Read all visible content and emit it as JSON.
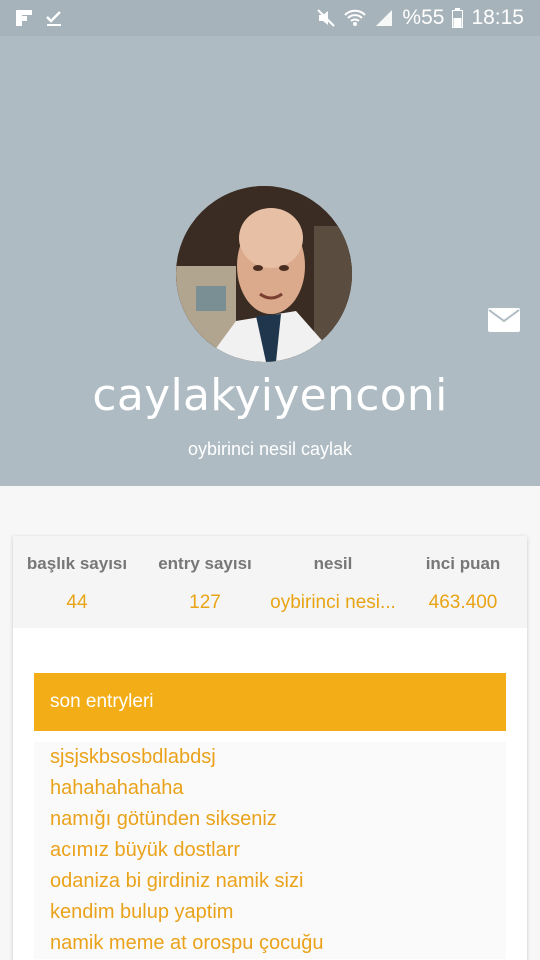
{
  "status_bar": {
    "battery": "%55",
    "time": "18:15",
    "icons": [
      "flipboard-icon",
      "checkmark-icon",
      "mute-icon",
      "wifi-icon",
      "signal-icon",
      "battery-icon"
    ]
  },
  "profile": {
    "username": "caylakyiyenconi",
    "generation": "oybirinci nesil caylak"
  },
  "stats": [
    {
      "label": "başlık sayısı",
      "value": "44"
    },
    {
      "label": "entry sayısı",
      "value": "127"
    },
    {
      "label": "nesil",
      "value": "oybirinci nesi..."
    },
    {
      "label": "inci puan",
      "value": "463.400"
    }
  ],
  "recent_entries": {
    "title": "son entryleri",
    "items": [
      "sjsjskbsosbdlabdsj",
      "hahahahahaha",
      "namığı götünden sikseniz",
      "acımız büyük dostlarr",
      "odaniza bi girdiniz namik sizi",
      "kendim bulup yaptim",
      "namik meme at orospu çocuğu"
    ]
  },
  "colors": {
    "header_bg": "#aebbc3",
    "accent": "#f2ad17",
    "value_text": "#e9a416"
  }
}
